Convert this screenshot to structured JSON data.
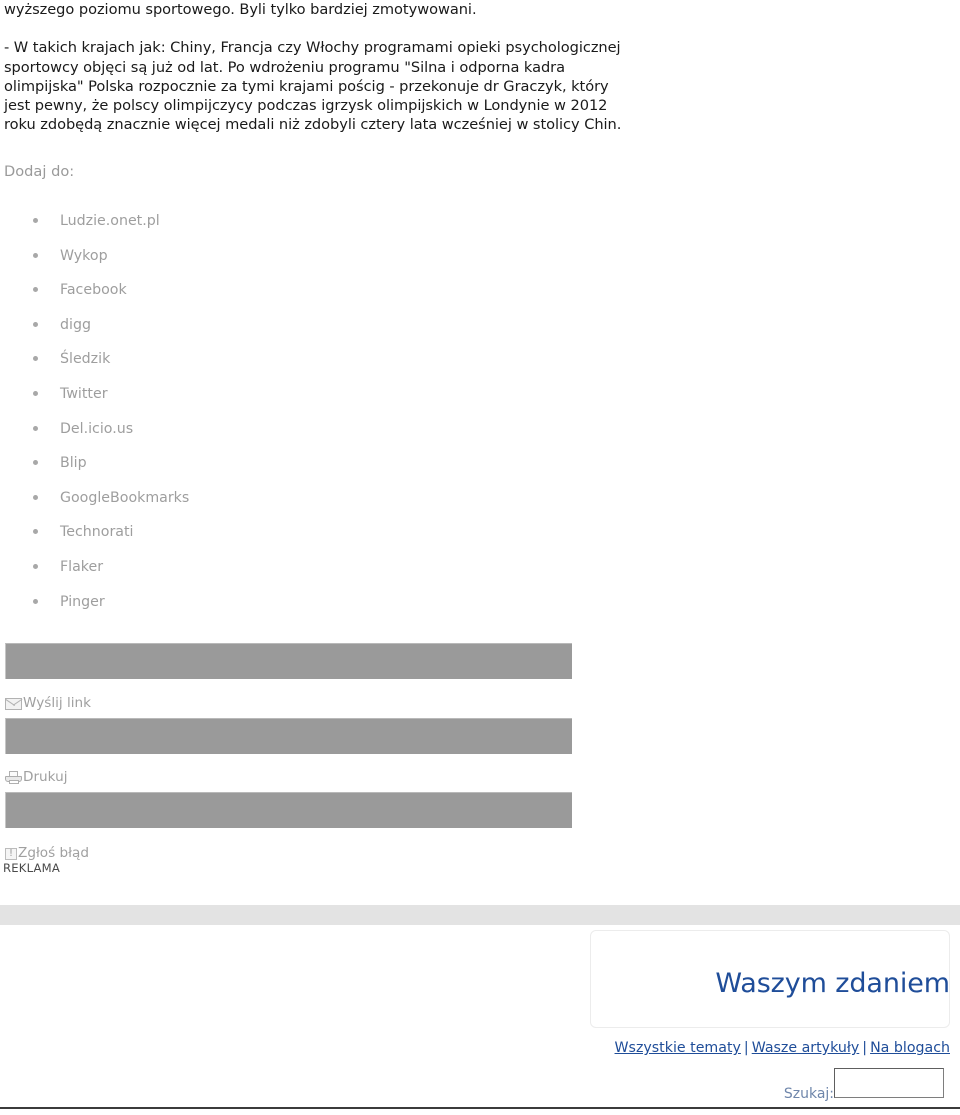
{
  "article": {
    "paragraphs": [
      "wyższego poziomu sportowego. Byli tylko bardziej zmotywowani.",
      "- W takich krajach jak: Chiny, Francja czy Włochy programami opieki psychologicznej sportowcy objęci są już od lat. Po wdrożeniu programu \"Silna i odporna kadra olimpijska\" Polska rozpocznie za tymi krajami pościg - przekonuje dr Graczyk, który jest pewny, że polscy olimpijczycy podczas igrzysk olimpijskich w Londynie w 2012 roku zdobędą znacznie więcej medali niż zdobyli cztery lata wcześniej w stolicy Chin."
    ]
  },
  "share": {
    "label": "Dodaj do:",
    "items": [
      "Ludzie.onet.pl",
      "Wykop",
      "Facebook",
      "digg",
      "Śledzik",
      "Twitter",
      "Del.icio.us",
      "Blip",
      "GoogleBookmarks",
      "Technorati",
      "Flaker",
      "Pinger"
    ]
  },
  "actions": {
    "send_link": "Wyślij link",
    "send_link_icon": "envelope-icon",
    "print": "Drukuj",
    "print_icon": "printer-icon",
    "report_error": "Zgłoś błąd",
    "report_error_icon": "warning-icon",
    "warning_glyph": "!"
  },
  "ads": {
    "label": "REKLAMA"
  },
  "opinion": {
    "title": "Waszym zdaniem",
    "links": [
      "Wszystkie tematy",
      "Wasze artykuły",
      "Na blogach"
    ],
    "separator": "|",
    "search_label": "Szukaj:",
    "search_value": "",
    "search_placeholder": ""
  },
  "colors": {
    "brand_blue": "#1f4d99",
    "muted_grey": "#9e9e9e",
    "bar_grey": "#9a9a9a",
    "band_grey": "#e3e3e3"
  }
}
